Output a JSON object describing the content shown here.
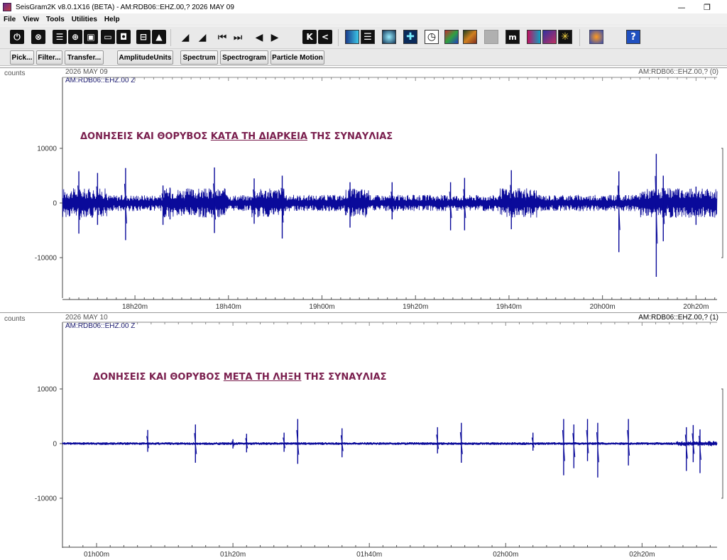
{
  "window": {
    "title": "SeisGram2K v8.0.1X16 (BETA) - AM:RDB06::EHZ.00,? 2026 MAY 09",
    "minimize_glyph": "—",
    "maximize_glyph": "❐"
  },
  "menu": [
    "File",
    "View",
    "Tools",
    "Utilities",
    "Help"
  ],
  "toolbar_icons": [
    "power-icon",
    "close-trace-icon",
    "trace-layout-icon",
    "globe-icon",
    "window-icon",
    "window-dot-icon",
    "panel-icon",
    "image-icon",
    "volume-down-icon",
    "volume-up-icon",
    "skip-to-start-icon",
    "skip-to-end-icon",
    "arrow-left-icon",
    "arrow-right-icon",
    "jump-first-icon",
    "jump-prev-icon",
    "filter-bank-icon",
    "list-icon",
    "rotate-icon",
    "crosshair-icon",
    "clock-icon",
    "color-map-icon",
    "picks-icon",
    "gray-icon",
    "magnitude-icon",
    "spectrum-color-icon",
    "star-burst-icon",
    "app-logo-icon",
    "help-icon"
  ],
  "toolbar_glyphs": {
    "k_label": "K",
    "lt_label": "<",
    "m_label": "m",
    "help_label": "?"
  },
  "buttons": {
    "pick": "Pick...",
    "filter": "Filter...",
    "transfer": "Transfer...",
    "amplitude_units": "AmplitudeUnits",
    "spectrum": "Spectrum",
    "spectrogram": "Spectrogram",
    "particle_motion": "Particle Motion"
  },
  "panels": [
    {
      "units": "counts",
      "date": "2026 MAY 09",
      "channel": "AM:RDB06::EHZ.00 Z",
      "channel_right": "AM:RDB06::EHZ.00,? (0)",
      "annotation": {
        "before": "ΔΟΝΗΣΕΙΣ ΚΑΙ ΘΟΡΥΒΟΣ ",
        "underlined": "ΚΑΤΑ ΤΗ ΔΙΑΡΚΕΙΑ",
        "after": " ΤΗΣ ΣΥΝΑΥΛΙΑΣ"
      }
    },
    {
      "units": "counts",
      "date": "2026 MAY 10",
      "channel": "AM:RDB06::EHZ.00 Z",
      "channel_right": "AM:RDB06::EHZ.00,? (1)",
      "annotation": {
        "before": "ΔΟΝΗΣΕΙΣ ΚΑΙ ΘΟΡΥΒΟΣ ",
        "underlined": "ΜΕΤΑ ΤΗ ΛΗΞΗ",
        "after": " ΤΗΣ ΣΥΝΑΥΛΙΑΣ"
      }
    }
  ],
  "chart_data": [
    {
      "type": "line",
      "title": "",
      "ylabel": "counts",
      "ylim": [
        -15000,
        15000
      ],
      "yticks": [
        "10000",
        "0",
        "-10000"
      ],
      "ytick_values": [
        10000,
        0,
        -10000
      ],
      "xlim": [
        4.5,
        144.5
      ],
      "x_ticks": [
        "18h20m",
        "18h40m",
        "19h00m",
        "19h20m",
        "19h40m",
        "20h00m",
        "20h20m"
      ],
      "x_tick_minutes": [
        20,
        40,
        60,
        80,
        100,
        120,
        140
      ],
      "color": "#0a0a9a",
      "noise_amplitude": 1600,
      "spikes": [
        {
          "t": 8.0,
          "hi": 5800,
          "lo": -5600
        },
        {
          "t": 12.0,
          "hi": 5500,
          "lo": -4000
        },
        {
          "t": 18.0,
          "hi": 6400,
          "lo": -6800
        },
        {
          "t": 26.0,
          "hi": 3200,
          "lo": -4000
        },
        {
          "t": 27.5,
          "hi": 2800,
          "lo": -3000
        },
        {
          "t": 37.0,
          "hi": 6500,
          "lo": -5500
        },
        {
          "t": 45.5,
          "hi": 4500,
          "lo": -3800
        },
        {
          "t": 51.5,
          "hi": 5000,
          "lo": -6500
        },
        {
          "t": 66.0,
          "hi": 3800,
          "lo": -4500
        },
        {
          "t": 75.0,
          "hi": 3800,
          "lo": -3000
        },
        {
          "t": 87.5,
          "hi": 3800,
          "lo": -5000
        },
        {
          "t": 90.5,
          "hi": 4600,
          "lo": -5000
        },
        {
          "t": 100.5,
          "hi": 6000,
          "lo": -4800
        },
        {
          "t": 123.5,
          "hi": 5800,
          "lo": -9000
        },
        {
          "t": 131.5,
          "hi": 9000,
          "lo": -13500
        },
        {
          "t": 133.0,
          "hi": 5000,
          "lo": -7000
        },
        {
          "t": 140.0,
          "hi": 3000,
          "lo": -4000
        }
      ],
      "loud_segments": [
        [
          4.5,
          14
        ],
        [
          26,
          40
        ],
        [
          45,
          52
        ],
        [
          65,
          70
        ],
        [
          98,
          106
        ],
        [
          128,
          144.5
        ]
      ]
    },
    {
      "type": "line",
      "title": "",
      "ylabel": "counts",
      "ylim": [
        -15000,
        15000
      ],
      "yticks": [
        "10000",
        "0",
        "-10000"
      ],
      "ytick_values": [
        10000,
        0,
        -10000
      ],
      "xlim": [
        55,
        151
      ],
      "x_ticks": [
        "01h00m",
        "01h20m",
        "01h40m",
        "02h00m",
        "02h20m"
      ],
      "x_tick_minutes": [
        60,
        80,
        100,
        120,
        140
      ],
      "color": "#0a0a9a",
      "noise_amplitude": 280,
      "spikes": [
        {
          "t": 67.5,
          "hi": 2500,
          "lo": -1500
        },
        {
          "t": 74.5,
          "hi": 3500,
          "lo": -3500
        },
        {
          "t": 80.0,
          "hi": 800,
          "lo": -900
        },
        {
          "t": 82.0,
          "hi": 1800,
          "lo": -1600
        },
        {
          "t": 87.5,
          "hi": 2000,
          "lo": -1500
        },
        {
          "t": 89.5,
          "hi": 4500,
          "lo": -3700
        },
        {
          "t": 96.0,
          "hi": 2800,
          "lo": -2500
        },
        {
          "t": 110.0,
          "hi": 3000,
          "lo": -1800
        },
        {
          "t": 113.5,
          "hi": 3800,
          "lo": -3500
        },
        {
          "t": 124.0,
          "hi": 2000,
          "lo": -1300
        },
        {
          "t": 128.5,
          "hi": 4500,
          "lo": -5800
        },
        {
          "t": 130.0,
          "hi": 3500,
          "lo": -4500
        },
        {
          "t": 132.0,
          "hi": 4500,
          "lo": -3200
        },
        {
          "t": 133.5,
          "hi": 3800,
          "lo": -6200
        },
        {
          "t": 138.0,
          "hi": 4500,
          "lo": -4000
        },
        {
          "t": 146.5,
          "hi": 3000,
          "lo": -5000
        },
        {
          "t": 147.5,
          "hi": 3400,
          "lo": -3400
        },
        {
          "t": 148.5,
          "hi": 2600,
          "lo": -5400
        }
      ],
      "loud_segments": [
        [
          145,
          151
        ]
      ]
    }
  ]
}
